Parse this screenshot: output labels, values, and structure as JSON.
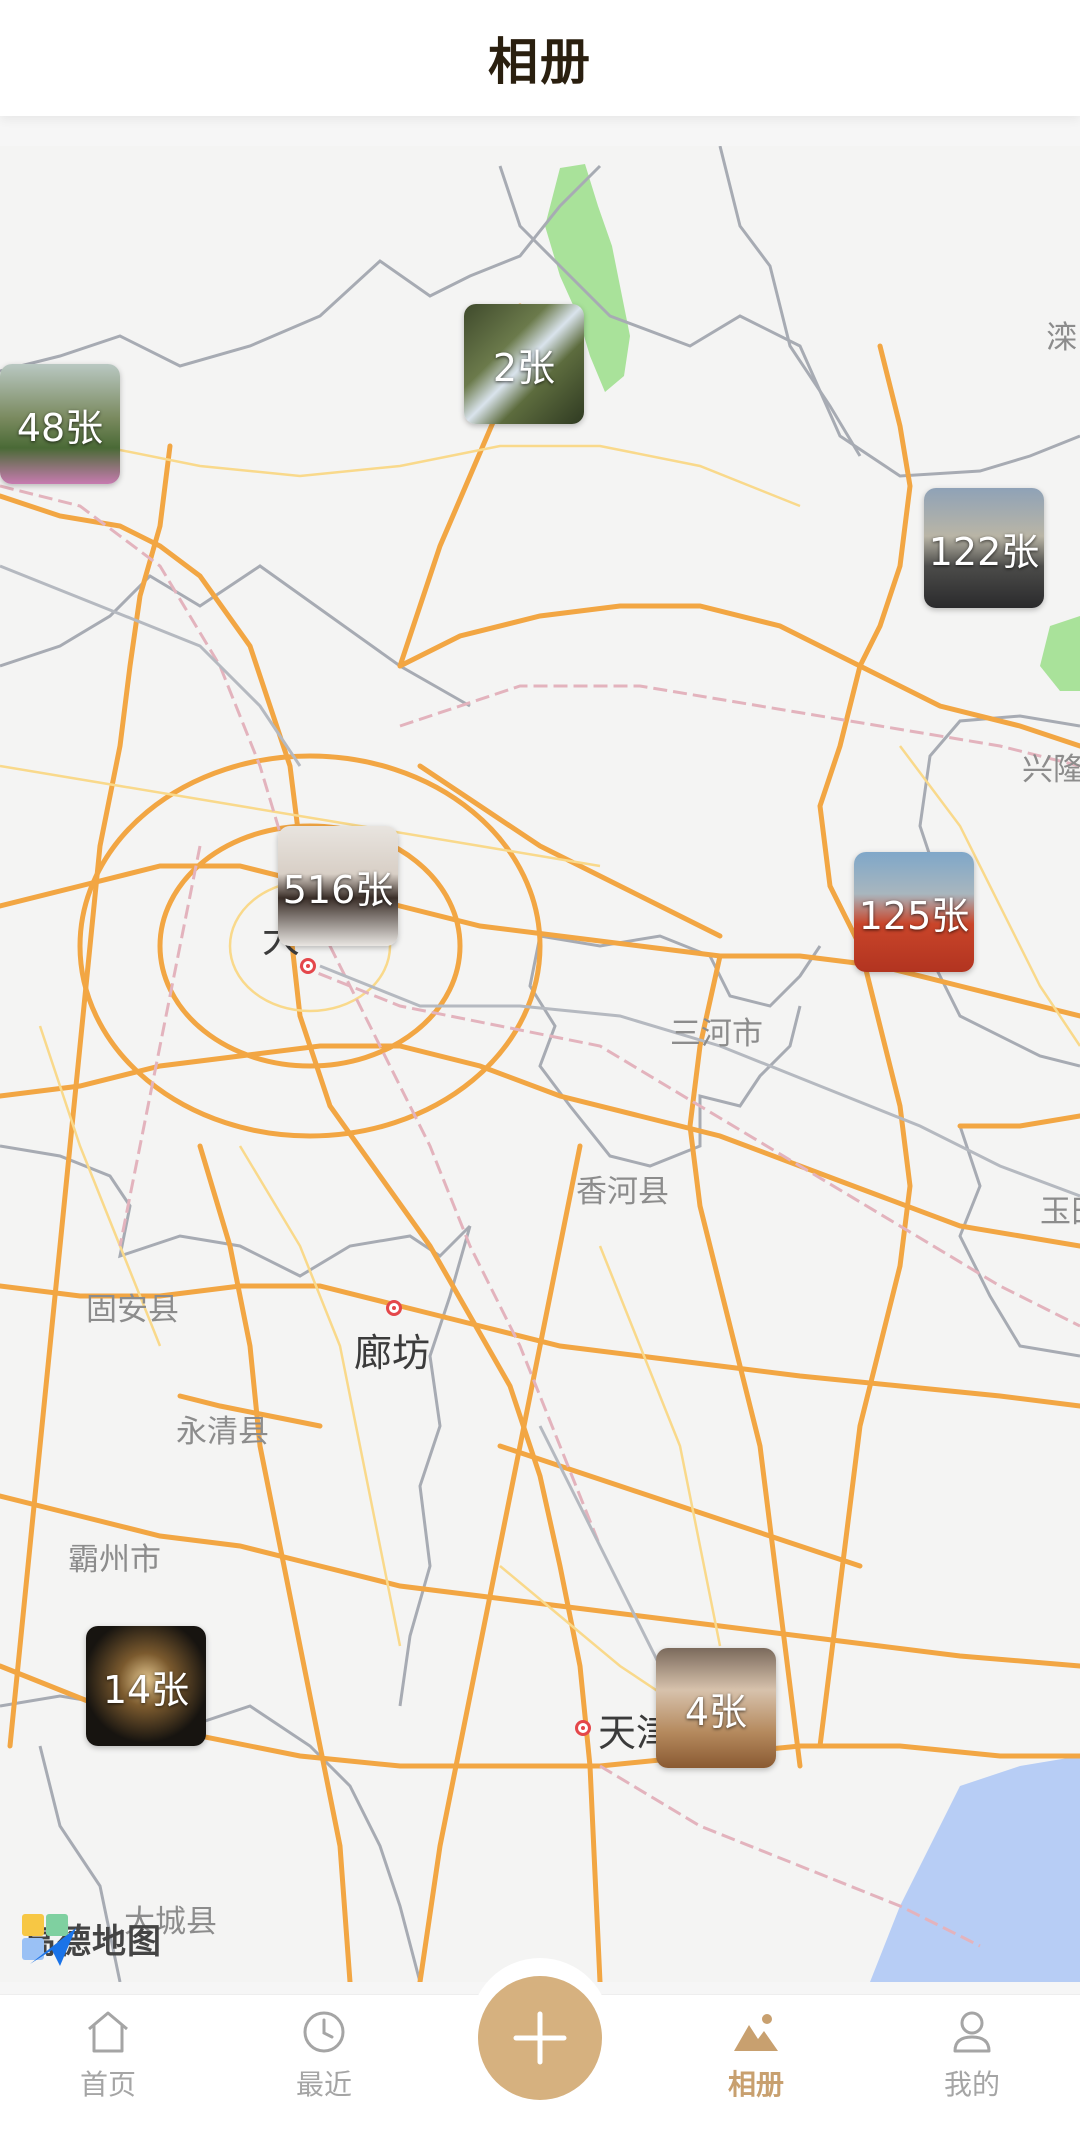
{
  "header": {
    "title": "相册"
  },
  "map": {
    "places": [
      {
        "name": "三河市",
        "type": "town"
      },
      {
        "name": "香河县",
        "type": "town"
      },
      {
        "name": "固安县",
        "type": "town"
      },
      {
        "name": "廊坊",
        "type": "city"
      },
      {
        "name": "永清县",
        "type": "town"
      },
      {
        "name": "霸州市",
        "type": "town"
      },
      {
        "name": "大城县",
        "type": "town"
      },
      {
        "name": "天津",
        "type": "city"
      },
      {
        "name": "兴隆",
        "type": "town"
      },
      {
        "name": "滦",
        "type": "town"
      },
      {
        "name": "玉田",
        "type": "town"
      },
      {
        "name": "大",
        "type": "city"
      }
    ],
    "photo_clusters": [
      {
        "count": "48张"
      },
      {
        "count": "2张"
      },
      {
        "count": "122张"
      },
      {
        "count": "516张"
      },
      {
        "count": "125张"
      },
      {
        "count": "14张"
      },
      {
        "count": "4张"
      }
    ],
    "logo": {
      "text": "高德地图"
    }
  },
  "tabbar": {
    "home": {
      "label": "首页",
      "icon": "home-icon"
    },
    "recent": {
      "label": "最近",
      "icon": "clock-icon"
    },
    "add": {
      "icon": "plus-icon"
    },
    "album": {
      "label": "相册",
      "icon": "mountain-icon"
    },
    "me": {
      "label": "我的",
      "icon": "person-icon"
    }
  },
  "colors": {
    "accent": "#c8a06f",
    "fab": "#d6b17f",
    "road": "#f2a643",
    "water": "#b7cdf5",
    "park": "#a9e29a"
  }
}
